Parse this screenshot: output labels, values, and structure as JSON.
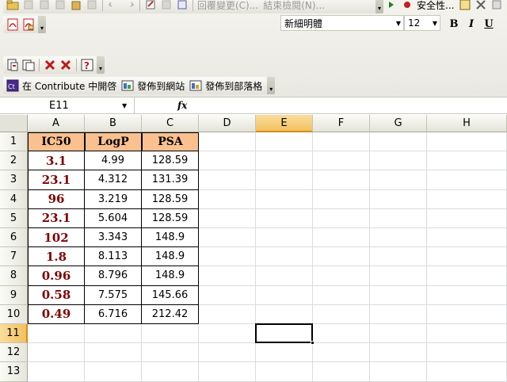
{
  "toolbar": {
    "reply_changes_label": "回覆變更(C)...",
    "end_review_label": "結束檢閱(N)...",
    "security_label": "安全性...",
    "contribute_label": "在 Contribute 中開啓",
    "publish_site_label": "發佈到網站",
    "publish_blog_label": "發佈到部落格",
    "font_name": "新細明體",
    "font_size": "12",
    "bold_label": "B",
    "italic_label": "I",
    "underline_label": "U"
  },
  "formula_bar": {
    "name_box": "E11",
    "fx_label": "fx",
    "formula": ""
  },
  "sheet": {
    "columns": [
      "A",
      "B",
      "C",
      "D",
      "E",
      "F",
      "G",
      "H"
    ],
    "rows": [
      "1",
      "2",
      "3",
      "4",
      "5",
      "6",
      "7",
      "8",
      "9",
      "10",
      "11",
      "12",
      "13"
    ],
    "selected_column": "E",
    "selected_row": "11",
    "headers": [
      "IC50",
      "LogP",
      "PSA"
    ],
    "data": [
      [
        "3.1",
        "4.99",
        "128.59"
      ],
      [
        "23.1",
        "4.312",
        "131.39"
      ],
      [
        "96",
        "3.219",
        "128.59"
      ],
      [
        "23.1",
        "5.604",
        "128.59"
      ],
      [
        "102",
        "3.343",
        "148.9"
      ],
      [
        "1.8",
        "8.113",
        "148.9"
      ],
      [
        "0.96",
        "8.796",
        "148.9"
      ],
      [
        "0.58",
        "7.575",
        "145.66"
      ],
      [
        "0.49",
        "6.716",
        "212.42"
      ]
    ]
  },
  "colors": {
    "header_fill": "#fac090",
    "ic50_text": "#800000",
    "selection_accent": "#f2c160"
  }
}
